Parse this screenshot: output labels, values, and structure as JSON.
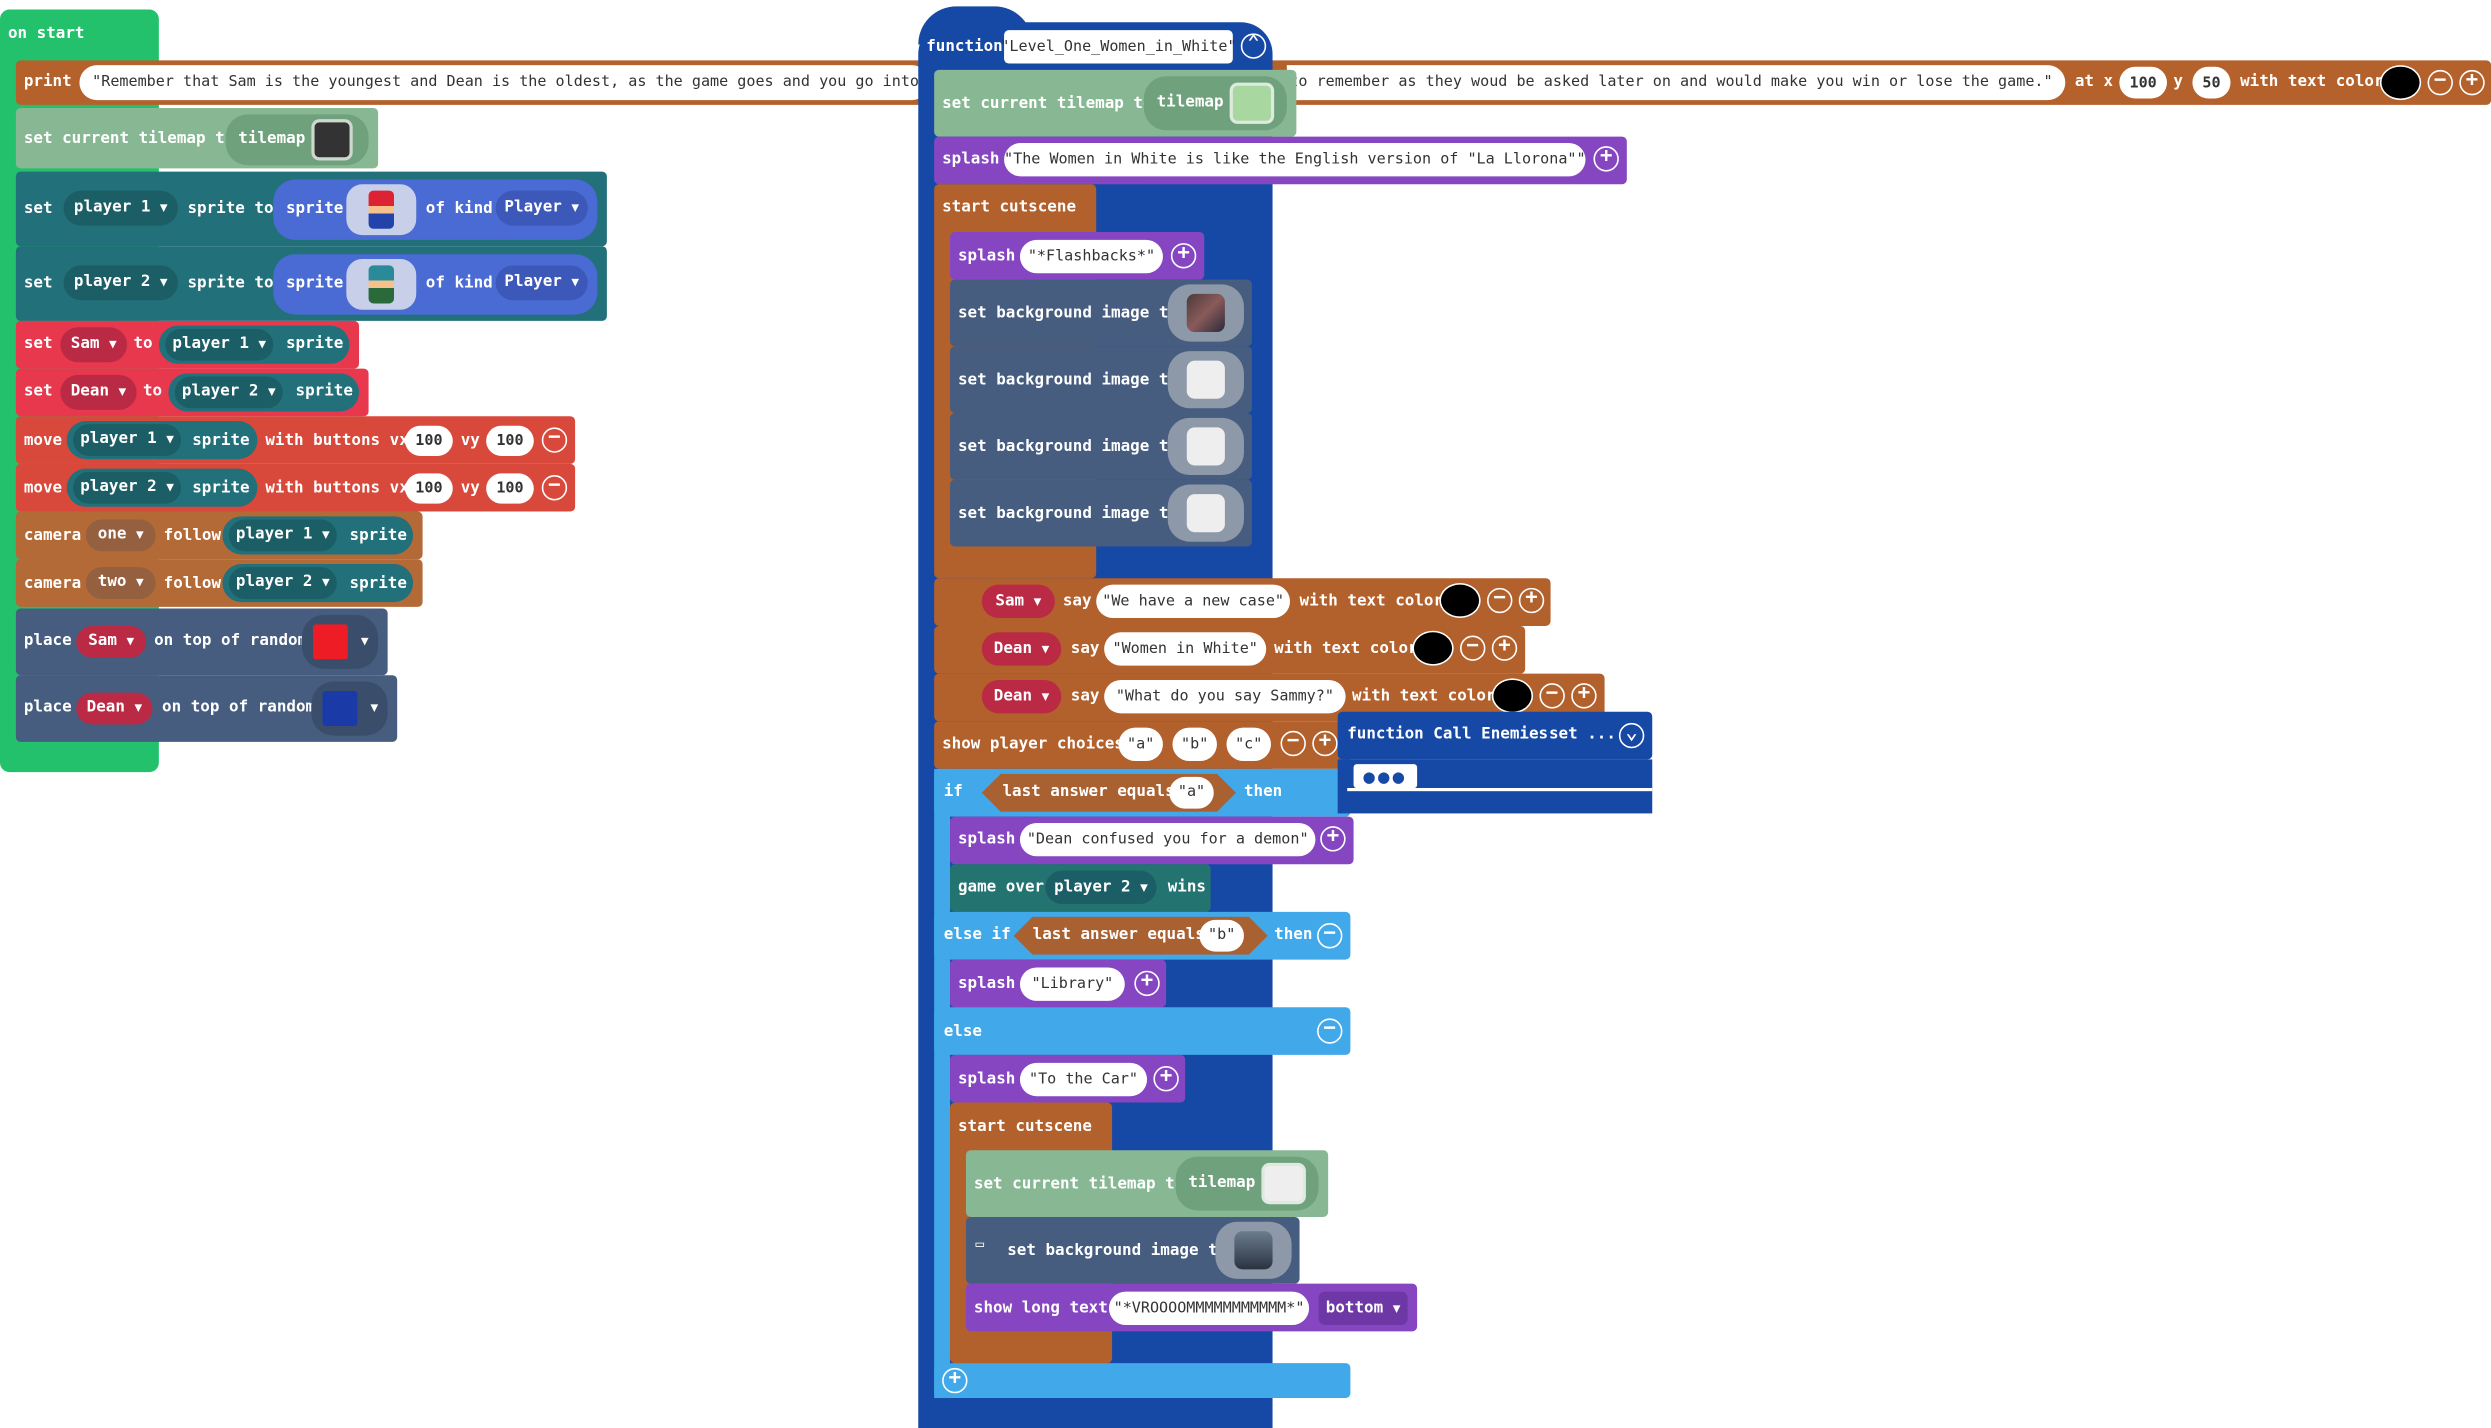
{
  "colors": {
    "events": "#23c16b",
    "text": "#b4612c",
    "scene": "#88b893",
    "scene_pill": "#6fa27c",
    "sprites": "#22707a",
    "sprite_pill": "#4b6bd4",
    "variables": "#e8384e",
    "var_dark": "#bb2a44",
    "controller": "#d8483b",
    "camera": "#b36a37",
    "camera_pill": "#956040",
    "place": "#465d80",
    "functions": "#1649a5",
    "logic": "#41a8ea",
    "splash": "#8646c2",
    "cutscene": "#b2602c",
    "background": "#465d80",
    "gameover": "#237371",
    "answer_hex": "#aa6132"
  },
  "on_start": {
    "hat_label": "on start",
    "print": {
      "keyword": "print",
      "text": "Remember that Sam is the youngest and Dean is the oldest, as the game goes and you go into lev",
      "text_tail": "d to remember as they woud be asked later on and would make you win or lose the game.",
      "at_x": "at x",
      "x": "100",
      "y_label": "y",
      "y": "50",
      "color_label": "with text color"
    },
    "set_tilemap": {
      "label": "set current tilemap to",
      "pill": "tilemap"
    },
    "set_player1": {
      "set": "set",
      "var": "player 1",
      "sprite_to": "sprite to",
      "sprite": "sprite",
      "of_kind": "of kind",
      "kind": "Player"
    },
    "set_player2": {
      "set": "set",
      "var": "player 2",
      "sprite_to": "sprite to",
      "sprite": "sprite",
      "of_kind": "of kind",
      "kind": "Player"
    },
    "set_sam": {
      "set": "set",
      "var": "Sam",
      "to": "to",
      "player": "player 1",
      "sprite": "sprite"
    },
    "set_dean": {
      "set": "set",
      "var": "Dean",
      "to": "to",
      "player": "player 2",
      "sprite": "sprite"
    },
    "move1": {
      "move": "move",
      "player": "player 1",
      "sprite": "sprite",
      "with": "with buttons vx",
      "vx": "100",
      "vy_label": "vy",
      "vy": "100"
    },
    "move2": {
      "move": "move",
      "player": "player 2",
      "sprite": "sprite",
      "with": "with buttons vx",
      "vx": "100",
      "vy_label": "vy",
      "vy": "100"
    },
    "camera1": {
      "camera": "camera",
      "which": "one",
      "follow": "follow",
      "player": "player 1",
      "sprite": "sprite"
    },
    "camera2": {
      "camera": "camera",
      "which": "two",
      "follow": "follow",
      "player": "player 2",
      "sprite": "sprite"
    },
    "place_sam": {
      "place": "place",
      "var": "Sam",
      "on_top": "on top of random",
      "tile_color": "#ee1c24"
    },
    "place_dean": {
      "place": "place",
      "var": "Dean",
      "on_top": "on top of random",
      "tile_color": "#1a3aa8"
    }
  },
  "function_block": {
    "keyword": "function",
    "name": "Level_One_Women_in_White",
    "set_tilemap": {
      "label": "set current tilemap to",
      "pill": "tilemap"
    },
    "splash1": {
      "label": "splash",
      "text": "The Women in White is like the English version of \"La Llorona\""
    },
    "cutscene1": {
      "label": "start cutscene",
      "splash": {
        "label": "splash",
        "text": "*Flashbacks*"
      },
      "bg_label": "set background image to"
    },
    "say1": {
      "who": "Sam",
      "say": "say",
      "text": "We have a new case",
      "color_label": "with text color"
    },
    "say2": {
      "who": "Dean",
      "say": "say",
      "text": "Women in White",
      "color_label": "with text color"
    },
    "say3": {
      "who": "Dean",
      "say": "say",
      "text": "What do you say Sammy?",
      "color_label": "with text color"
    },
    "choices": {
      "label": "show player choices",
      "a": "a",
      "b": "b",
      "c": "c"
    },
    "if1": {
      "if": "if",
      "cond": "last answer equals",
      "val": "a",
      "then": "then"
    },
    "splash2": {
      "label": "splash",
      "text": "Dean confused you for a demon"
    },
    "gameover": {
      "label": "game over",
      "player": "player 2",
      "wins": "wins"
    },
    "elseif": {
      "label": "else if",
      "cond": "last answer equals",
      "val": "b",
      "then": "then"
    },
    "splash3": {
      "label": "splash",
      "text": "Library"
    },
    "else": {
      "label": "else"
    },
    "splash4": {
      "label": "splash",
      "text": "To the Car"
    },
    "cutscene2": {
      "label": "start cutscene",
      "set_tilemap": {
        "label": "set current tilemap to",
        "pill": "tilemap"
      },
      "bg_label": "set background image to",
      "longtext": {
        "label": "show long text",
        "text": "*VROOOOMMMMMMMMMMM*",
        "pos": "bottom"
      }
    }
  },
  "call_enemies": {
    "label": "function Call Enemies",
    "set": "set ..."
  }
}
